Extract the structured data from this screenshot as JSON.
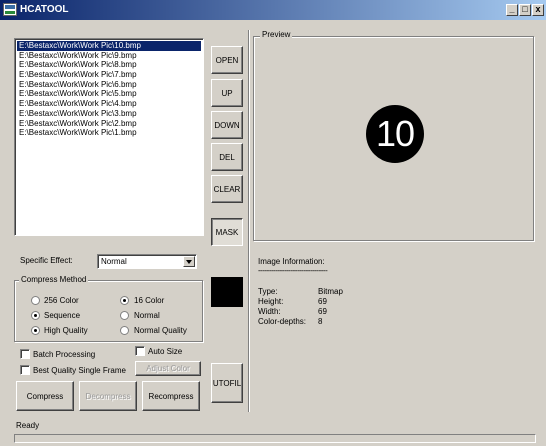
{
  "window": {
    "title": "HCATOOL",
    "controls": {
      "minimize": "_",
      "maximize": "□",
      "close": "x"
    }
  },
  "file_list": {
    "items": [
      "E:\\Bestaxc\\Work\\Work Pic\\10.bmp",
      "E:\\Bestaxc\\Work\\Work Pic\\9.bmp",
      "E:\\Bestaxc\\Work\\Work Pic\\8.bmp",
      "E:\\Bestaxc\\Work\\Work Pic\\7.bmp",
      "E:\\Bestaxc\\Work\\Work Pic\\6.bmp",
      "E:\\Bestaxc\\Work\\Work Pic\\5.bmp",
      "E:\\Bestaxc\\Work\\Work Pic\\4.bmp",
      "E:\\Bestaxc\\Work\\Work Pic\\3.bmp",
      "E:\\Bestaxc\\Work\\Work Pic\\2.bmp",
      "E:\\Bestaxc\\Work\\Work Pic\\1.bmp"
    ],
    "selected_index": 0
  },
  "list_buttons": {
    "open": "OPEN",
    "up": "UP",
    "down": "DOWN",
    "del": "DEL",
    "clear": "CLEAR",
    "mask": "MASK"
  },
  "preview": {
    "label": "Preview",
    "image_text": "10"
  },
  "specific_effect": {
    "label": "Specific Effect:",
    "value": "Normal"
  },
  "compress_method": {
    "label": "Compress Method",
    "color_256": "256 Color",
    "color_16": "16 Color",
    "sequence": "Sequence",
    "normal": "Normal",
    "high_quality": "High Quality",
    "normal_quality": "Normal Quality",
    "selected_color": "16 Color",
    "selected_order": "Sequence",
    "selected_quality": "High Quality"
  },
  "color_swatch": "#000000",
  "options": {
    "batch_processing": "Batch Processing",
    "auto_size": "Auto Size",
    "best_quality_single_frame": "Best Quality Single Frame",
    "adjust_color": "Adjust Color"
  },
  "action_buttons": {
    "compress": "Compress",
    "decompress": "Decompress",
    "recompress": "Recompress",
    "autofill": "UTOFIL"
  },
  "image_information": {
    "label": "Image Information:",
    "separator": "--------------------------------",
    "rows": [
      {
        "key": "Type:",
        "value": "Bitmap"
      },
      {
        "key": "Height:",
        "value": "69"
      },
      {
        "key": "Width:",
        "value": "69"
      },
      {
        "key": "Color-depths:",
        "value": "8"
      }
    ]
  },
  "status": {
    "text": "Ready"
  },
  "icons": {
    "app": "app-icon",
    "dropdown": "chevron-down-icon"
  }
}
